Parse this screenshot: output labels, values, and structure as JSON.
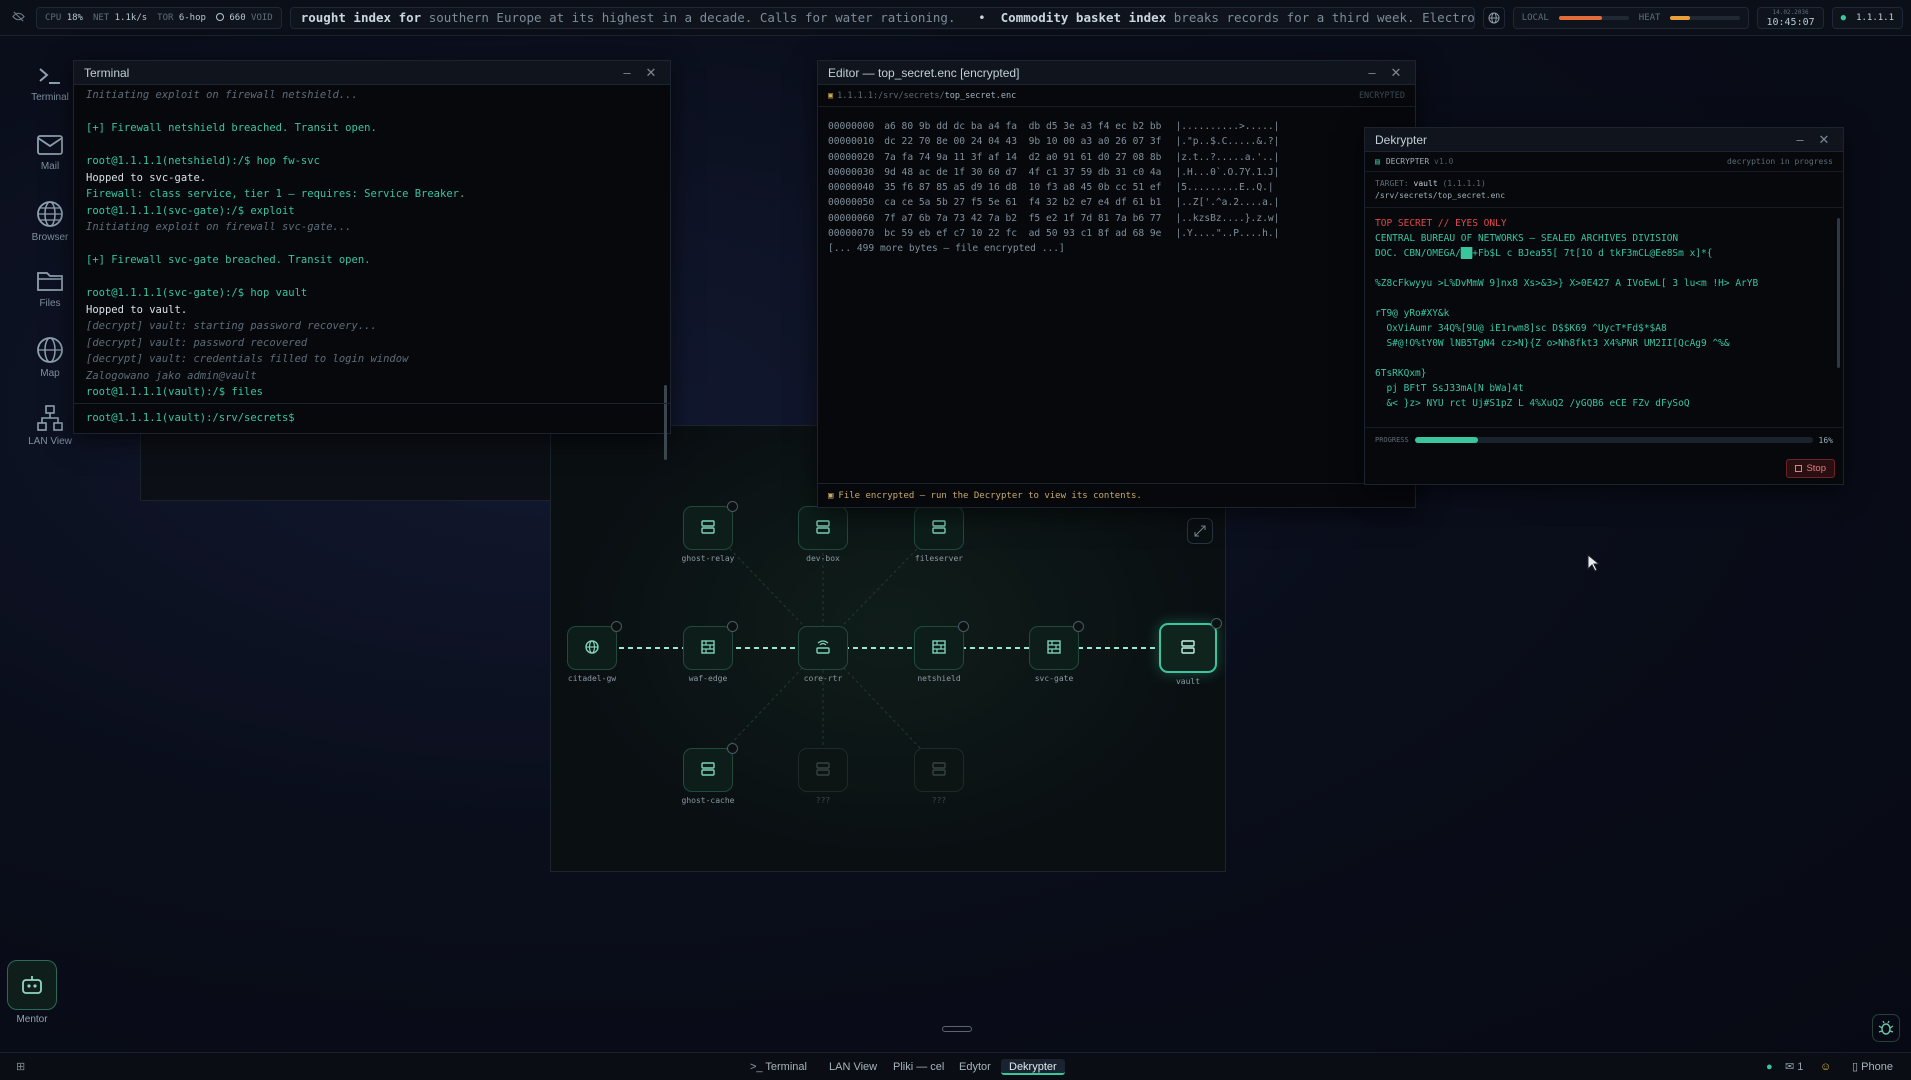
{
  "topbar": {
    "cpu_label": "CPU",
    "cpu": "18%",
    "net_label": "NET",
    "net": "1.1k/s",
    "tor_label": "TOR",
    "tor": "6-hop",
    "void_amount": "660",
    "void_label": "VOID",
    "local_label": "LOCAL",
    "heat_label": "HEAT",
    "local_level": 0.62,
    "heat_level": 0.28,
    "date": "14.02.2036",
    "time": "10:45:07",
    "ip": "1.1.1.1",
    "accent": "#3ac59c"
  },
  "ticker": {
    "seg1": "rought index for",
    "seg2": "southern Europe at its highest in a decade. Calls for water rationing.",
    "sep": "•",
    "seg3": "Commodity basket index",
    "seg4": "breaks records for a third week. Electronics makers warn of ri"
  },
  "sidebar": {
    "items": [
      {
        "label": "Terminal",
        "icon": "terminal-icon"
      },
      {
        "label": "Mail",
        "icon": "mail-icon"
      },
      {
        "label": "Browser",
        "icon": "globe-icon"
      },
      {
        "label": "Files",
        "icon": "folder-icon"
      },
      {
        "label": "Map",
        "icon": "map-icon"
      },
      {
        "label": "LAN View",
        "icon": "network-icon"
      }
    ],
    "mentor_label": "Mentor"
  },
  "terminal": {
    "title": "Terminal",
    "prompt": "root@1.1.1.1(vault):/srv/secrets$",
    "lines": [
      {
        "t": "Initiating exploit on firewall netshield...",
        "s": "dim"
      },
      {
        "t": "",
        "s": "w"
      },
      {
        "t": "[+] Firewall netshield breached. Transit open.",
        "s": "g"
      },
      {
        "t": "",
        "s": "w"
      },
      {
        "t": "root@1.1.1.1(netshield):/$ hop fw-svc",
        "s": "g"
      },
      {
        "t": "Hopped to svc-gate.",
        "s": "w"
      },
      {
        "t": "Firewall: class service, tier 1 — requires: Service Breaker.",
        "s": "g"
      },
      {
        "t": "root@1.1.1.1(svc-gate):/$ exploit",
        "s": "g"
      },
      {
        "t": "Initiating exploit on firewall svc-gate...",
        "s": "dim"
      },
      {
        "t": "",
        "s": "w"
      },
      {
        "t": "[+] Firewall svc-gate breached. Transit open.",
        "s": "g"
      },
      {
        "t": "",
        "s": "w"
      },
      {
        "t": "root@1.1.1.1(svc-gate):/$ hop vault",
        "s": "g"
      },
      {
        "t": "Hopped to vault.",
        "s": "w"
      },
      {
        "t": "[decrypt] vault: starting password recovery...",
        "s": "dim"
      },
      {
        "t": "[decrypt] vault: password recovered",
        "s": "dim"
      },
      {
        "t": "[decrypt] vault: credentials filled to login window",
        "s": "dim"
      },
      {
        "t": "Zalogowano jako admin@vault",
        "s": "dim"
      },
      {
        "t": "root@1.1.1.1(vault):/$ files",
        "s": "g"
      }
    ]
  },
  "editor": {
    "title": "Editor — top_secret.enc [encrypted]",
    "path_prefix": "1.1.1.1:/srv/secrets/",
    "path_file": "top_secret.enc",
    "badge": "ENCRYPTED",
    "footer": "File encrypted — run the Decrypter to view its contents.",
    "more": "[... 499 more bytes — file encrypted ...]",
    "hex": [
      {
        "o": "00000000",
        "b": "a6 80 9b dd dc ba a4 fa  db d5 3e a3 f4 ec b2 bb",
        "a": "|..........>.....|"
      },
      {
        "o": "00000010",
        "b": "dc 22 70 8e 00 24 04 43  9b 10 00 a3 a0 26 07 3f",
        "a": "|.\"p..$.C.....&.?|"
      },
      {
        "o": "00000020",
        "b": "7a fa 74 9a 11 3f af 14  d2 a0 91 61 d0 27 08 8b",
        "a": "|z.t..?.....a.'..|"
      },
      {
        "o": "00000030",
        "b": "9d 48 ac de 1f 30 60 d7  4f c1 37 59 db 31 c0 4a",
        "a": "|.H...0`.O.7Y.1.J|"
      },
      {
        "o": "00000040",
        "b": "35 f6 87 85 a5 d9 16 d8  10 f3 a8 45 0b cc 51 ef",
        "a": "|5.........E..Q.|"
      },
      {
        "o": "00000050",
        "b": "ca ce 5a 5b 27 f5 5e 61  f4 32 b2 e7 e4 df 61 b1",
        "a": "|..Z['.^a.2....a.|"
      },
      {
        "o": "00000060",
        "b": "7f a7 6b 7a 73 42 7a b2  f5 e2 1f 7d 81 7a b6 77",
        "a": "|..kzsBz....}.z.w|"
      },
      {
        "o": "00000070",
        "b": "bc 59 eb ef c7 10 22 fc  ad 50 93 c1 8f ad 68 9e",
        "a": "|.Y....\"..P....h.|"
      }
    ]
  },
  "decrypter": {
    "title": "Dekrypter",
    "app": "DECRYPTER",
    "version": "v1.0",
    "status": "decryption in progress",
    "target_label": "TARGET:",
    "target_host": "vault",
    "target_ip": "(1.1.1.1)",
    "target_path": "/srv/secrets/top_secret.enc",
    "progress_label": "PROGRESS",
    "progress": 0.16,
    "progress_text": "16%",
    "stop_label": "Stop",
    "lines": [
      {
        "t": "TOP SECRET // EYES ONLY",
        "s": "red"
      },
      {
        "t": "CENTRAL BUREAU OF NETWORKS — SEALED ARCHIVES DIVISION",
        "s": "g"
      },
      {
        "t": "DOC. CBN/OMEGA/██+Fb$L c BJea55[ 7t[1O d tkF3mCL@Ee8Sm x]*{",
        "s": "g"
      },
      {
        "t": "",
        "s": "g"
      },
      {
        "t": "%Z8cFkwyyu >L%DvMmW 9]nx8 Xs>&3>} X>0E427 A IVoEwL[ 3 lu<m !H> ArYB",
        "s": "g"
      },
      {
        "t": "",
        "s": "g"
      },
      {
        "t": "rT9@ yRo#XY&k",
        "s": "g"
      },
      {
        "t": "  OxViAumr 34Q%[9U@ iE1rwm8]sc D$$K69 ^UycT*Fd$*$A8",
        "s": "g"
      },
      {
        "t": "  S#@!O%tY0W lNB5TgN4 cz>N}{Z o>Nh8fkt3 X4%PNR UM2II[QcAg9 ^%&",
        "s": "g"
      },
      {
        "t": "",
        "s": "g"
      },
      {
        "t": "6TsRKQxm}",
        "s": "g"
      },
      {
        "t": "  pj BFtT SsJ33mA[N bWa]4t",
        "s": "g"
      },
      {
        "t": "  &< }z> NYU rct Uj#S1pZ L 4%XuQ2 /yGQB6 eCE FZv dFySoQ",
        "s": "g"
      }
    ]
  },
  "lan": {
    "nodes": [
      {
        "id": "ghost-relay",
        "label": "ghost-relay",
        "icon": "server-icon"
      },
      {
        "id": "dev-box",
        "label": "dev-box",
        "icon": "server-icon"
      },
      {
        "id": "fileserver",
        "label": "fileserver",
        "icon": "server-icon"
      },
      {
        "id": "citadel-gw",
        "label": "citadel-gw",
        "icon": "globe-icon"
      },
      {
        "id": "waf-edge",
        "label": "waf-edge",
        "icon": "firewall-icon"
      },
      {
        "id": "core-rtr",
        "label": "core-rtr",
        "icon": "router-icon"
      },
      {
        "id": "netshield",
        "label": "netshield",
        "icon": "firewall-icon"
      },
      {
        "id": "svc-gate",
        "label": "svc-gate",
        "icon": "firewall-icon"
      },
      {
        "id": "vault",
        "label": "vault",
        "icon": "server-icon"
      },
      {
        "id": "ghost-cache",
        "label": "ghost-cache",
        "icon": "server-icon"
      },
      {
        "id": "unknown-1",
        "label": "???",
        "icon": "server-icon"
      },
      {
        "id": "unknown-2",
        "label": "???",
        "icon": "server-icon"
      }
    ]
  },
  "taskbar": {
    "items": [
      "Terminal",
      "LAN View",
      "Pliki — cel",
      "Edytor",
      "Dekrypter"
    ],
    "active": "Dekrypter",
    "mail_count": "1",
    "phone_label": "Phone"
  }
}
